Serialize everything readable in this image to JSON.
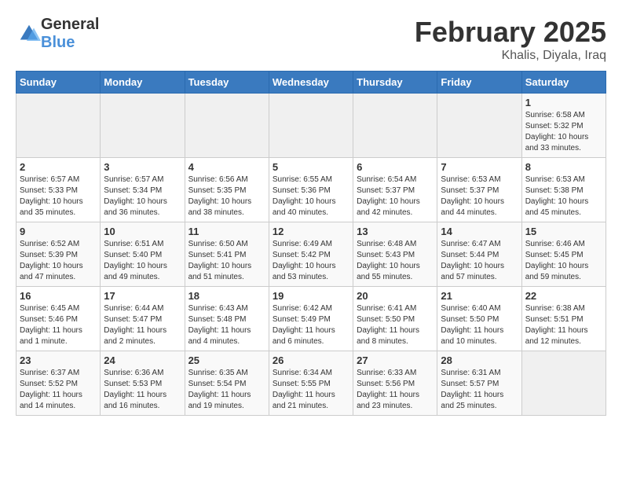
{
  "logo": {
    "general": "General",
    "blue": "Blue"
  },
  "title": {
    "month": "February 2025",
    "location": "Khalis, Diyala, Iraq"
  },
  "headers": [
    "Sunday",
    "Monday",
    "Tuesday",
    "Wednesday",
    "Thursday",
    "Friday",
    "Saturday"
  ],
  "weeks": [
    [
      {
        "day": "",
        "info": ""
      },
      {
        "day": "",
        "info": ""
      },
      {
        "day": "",
        "info": ""
      },
      {
        "day": "",
        "info": ""
      },
      {
        "day": "",
        "info": ""
      },
      {
        "day": "",
        "info": ""
      },
      {
        "day": "1",
        "info": "Sunrise: 6:58 AM\nSunset: 5:32 PM\nDaylight: 10 hours\nand 33 minutes."
      }
    ],
    [
      {
        "day": "2",
        "info": "Sunrise: 6:57 AM\nSunset: 5:33 PM\nDaylight: 10 hours\nand 35 minutes."
      },
      {
        "day": "3",
        "info": "Sunrise: 6:57 AM\nSunset: 5:34 PM\nDaylight: 10 hours\nand 36 minutes."
      },
      {
        "day": "4",
        "info": "Sunrise: 6:56 AM\nSunset: 5:35 PM\nDaylight: 10 hours\nand 38 minutes."
      },
      {
        "day": "5",
        "info": "Sunrise: 6:55 AM\nSunset: 5:36 PM\nDaylight: 10 hours\nand 40 minutes."
      },
      {
        "day": "6",
        "info": "Sunrise: 6:54 AM\nSunset: 5:37 PM\nDaylight: 10 hours\nand 42 minutes."
      },
      {
        "day": "7",
        "info": "Sunrise: 6:53 AM\nSunset: 5:37 PM\nDaylight: 10 hours\nand 44 minutes."
      },
      {
        "day": "8",
        "info": "Sunrise: 6:53 AM\nSunset: 5:38 PM\nDaylight: 10 hours\nand 45 minutes."
      }
    ],
    [
      {
        "day": "9",
        "info": "Sunrise: 6:52 AM\nSunset: 5:39 PM\nDaylight: 10 hours\nand 47 minutes."
      },
      {
        "day": "10",
        "info": "Sunrise: 6:51 AM\nSunset: 5:40 PM\nDaylight: 10 hours\nand 49 minutes."
      },
      {
        "day": "11",
        "info": "Sunrise: 6:50 AM\nSunset: 5:41 PM\nDaylight: 10 hours\nand 51 minutes."
      },
      {
        "day": "12",
        "info": "Sunrise: 6:49 AM\nSunset: 5:42 PM\nDaylight: 10 hours\nand 53 minutes."
      },
      {
        "day": "13",
        "info": "Sunrise: 6:48 AM\nSunset: 5:43 PM\nDaylight: 10 hours\nand 55 minutes."
      },
      {
        "day": "14",
        "info": "Sunrise: 6:47 AM\nSunset: 5:44 PM\nDaylight: 10 hours\nand 57 minutes."
      },
      {
        "day": "15",
        "info": "Sunrise: 6:46 AM\nSunset: 5:45 PM\nDaylight: 10 hours\nand 59 minutes."
      }
    ],
    [
      {
        "day": "16",
        "info": "Sunrise: 6:45 AM\nSunset: 5:46 PM\nDaylight: 11 hours\nand 1 minute."
      },
      {
        "day": "17",
        "info": "Sunrise: 6:44 AM\nSunset: 5:47 PM\nDaylight: 11 hours\nand 2 minutes."
      },
      {
        "day": "18",
        "info": "Sunrise: 6:43 AM\nSunset: 5:48 PM\nDaylight: 11 hours\nand 4 minutes."
      },
      {
        "day": "19",
        "info": "Sunrise: 6:42 AM\nSunset: 5:49 PM\nDaylight: 11 hours\nand 6 minutes."
      },
      {
        "day": "20",
        "info": "Sunrise: 6:41 AM\nSunset: 5:50 PM\nDaylight: 11 hours\nand 8 minutes."
      },
      {
        "day": "21",
        "info": "Sunrise: 6:40 AM\nSunset: 5:50 PM\nDaylight: 11 hours\nand 10 minutes."
      },
      {
        "day": "22",
        "info": "Sunrise: 6:38 AM\nSunset: 5:51 PM\nDaylight: 11 hours\nand 12 minutes."
      }
    ],
    [
      {
        "day": "23",
        "info": "Sunrise: 6:37 AM\nSunset: 5:52 PM\nDaylight: 11 hours\nand 14 minutes."
      },
      {
        "day": "24",
        "info": "Sunrise: 6:36 AM\nSunset: 5:53 PM\nDaylight: 11 hours\nand 16 minutes."
      },
      {
        "day": "25",
        "info": "Sunrise: 6:35 AM\nSunset: 5:54 PM\nDaylight: 11 hours\nand 19 minutes."
      },
      {
        "day": "26",
        "info": "Sunrise: 6:34 AM\nSunset: 5:55 PM\nDaylight: 11 hours\nand 21 minutes."
      },
      {
        "day": "27",
        "info": "Sunrise: 6:33 AM\nSunset: 5:56 PM\nDaylight: 11 hours\nand 23 minutes."
      },
      {
        "day": "28",
        "info": "Sunrise: 6:31 AM\nSunset: 5:57 PM\nDaylight: 11 hours\nand 25 minutes."
      },
      {
        "day": "",
        "info": ""
      }
    ]
  ]
}
